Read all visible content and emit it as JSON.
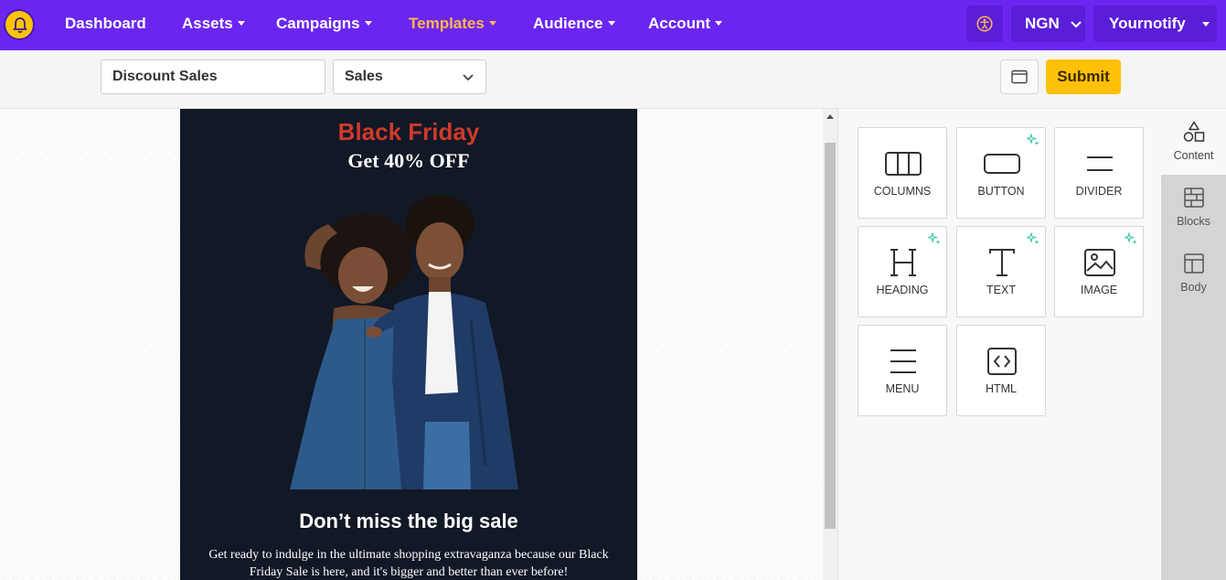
{
  "nav": {
    "items": [
      {
        "label": "Dashboard",
        "dropdown": false,
        "active": false
      },
      {
        "label": "Assets",
        "dropdown": true,
        "active": false
      },
      {
        "label": "Campaigns",
        "dropdown": true,
        "active": false
      },
      {
        "label": "Templates",
        "dropdown": true,
        "active": true
      },
      {
        "label": "Audience",
        "dropdown": true,
        "active": false
      },
      {
        "label": "Account",
        "dropdown": true,
        "active": false
      }
    ],
    "currency": "NGN",
    "user": "Yournotify",
    "icons": {
      "logo": "bell-icon",
      "accessibility": "accessibility-icon"
    }
  },
  "toolbar": {
    "template_name": "Discount Sales",
    "category": "Sales",
    "submit_label": "Submit"
  },
  "email": {
    "title": "Black Friday",
    "subtitle": "Get 40% OFF",
    "heading": "Don’t miss the big sale",
    "paragraph": "Get ready to indulge in the ultimate shopping extravaganza because our Black Friday Sale is here, and it's bigger and better than ever before!"
  },
  "tools": [
    {
      "label": "COLUMNS",
      "icon": "columns-icon",
      "ai": false
    },
    {
      "label": "BUTTON",
      "icon": "button-icon",
      "ai": true
    },
    {
      "label": "DIVIDER",
      "icon": "divider-icon",
      "ai": false
    },
    {
      "label": "HEADING",
      "icon": "heading-icon",
      "ai": true
    },
    {
      "label": "TEXT",
      "icon": "text-icon",
      "ai": true
    },
    {
      "label": "IMAGE",
      "icon": "image-icon",
      "ai": true
    },
    {
      "label": "MENU",
      "icon": "menu-icon",
      "ai": false
    },
    {
      "label": "HTML",
      "icon": "html-icon",
      "ai": false
    }
  ],
  "side_tabs": [
    {
      "label": "Content",
      "icon": "shapes-icon",
      "active": true
    },
    {
      "label": "Blocks",
      "icon": "blocks-icon",
      "active": false
    },
    {
      "label": "Body",
      "icon": "layout-icon",
      "active": false
    }
  ],
  "colors": {
    "nav_bg": "#6a26f0",
    "active_nav": "#ffb74d",
    "submit_bg": "#ffc107",
    "email_bg": "#111826",
    "title_red": "#d03a2a",
    "sparkle": "#2ec4a0"
  }
}
